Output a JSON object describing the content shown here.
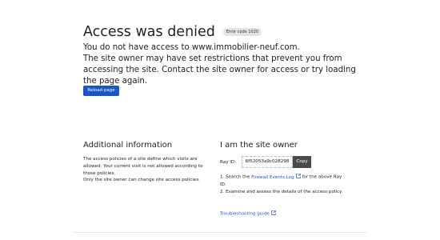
{
  "header": {
    "title": "Access was denied",
    "error_code": "Error code 1020"
  },
  "message": {
    "line1": "You do not have access to www.immobilier-neuf.com.",
    "line2": "The site owner may have set restrictions that prevent you from accessing the site. Contact the site owner for access or try loading the page again."
  },
  "reload_button": "Reload page",
  "additional": {
    "heading": "Additional information",
    "para1": "The access policies of a site define which visits are allowed. Your current visit is not allowed according to those policies.",
    "para2": "Only the site owner can change site access policies."
  },
  "owner": {
    "heading": "I am the site owner",
    "ray_label": "Ray ID:",
    "ray_id": "6f52053a9c028298",
    "copy_label": "Copy",
    "step1_prefix": "1. Search the ",
    "step1_link": "Firewall Events Log",
    "step1_suffix": " for the above Ray ID.",
    "step2": "2. Examine and assess the details of the access policy.",
    "troubleshooting": "Troubleshooting guide"
  },
  "colors": {
    "accent": "#1a56c5",
    "copy_button": "#4a4a4a",
    "badge": "#e3e3e3"
  },
  "icons": {
    "external_link": "external-link-icon"
  }
}
